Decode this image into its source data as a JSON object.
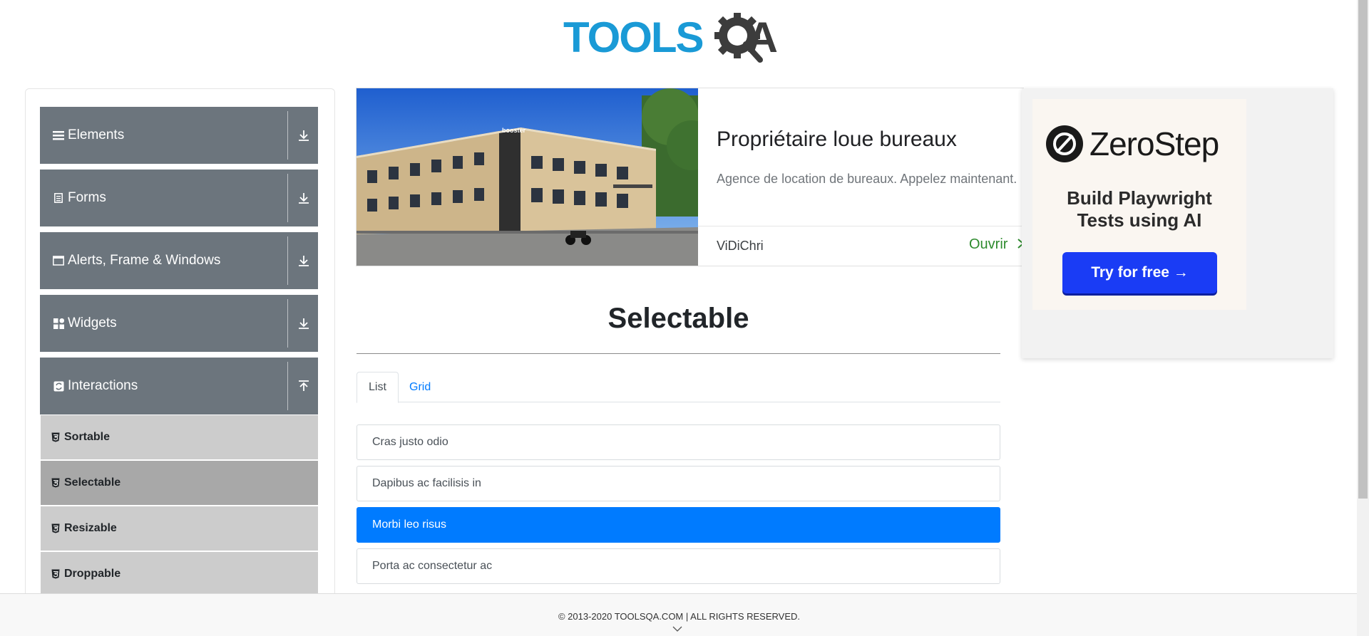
{
  "header": {
    "logo_tools": "TOOLS",
    "logo_qa": "A",
    "logo_icon": "gear-magnifier-icon"
  },
  "sidebar": {
    "groups": [
      {
        "label": "Elements",
        "icon": "hamburger-icon",
        "arrow": "download-icon"
      },
      {
        "label": "Forms",
        "icon": "document-icon",
        "arrow": "download-icon"
      },
      {
        "label": "Alerts, Frame & Windows",
        "icon": "window-icon",
        "arrow": "download-icon"
      },
      {
        "label": "Widgets",
        "icon": "grid-icon",
        "arrow": "download-icon"
      },
      {
        "label": "Interactions",
        "icon": "interaction-icon",
        "arrow": "upload-icon"
      }
    ],
    "items": [
      {
        "label": "Sortable"
      },
      {
        "label": "Selectable",
        "active": true
      },
      {
        "label": "Resizable"
      },
      {
        "label": "Droppable"
      }
    ]
  },
  "ad": {
    "title": "Propriétaire loue bureaux",
    "description": "Agence de location de bureaux. Appelez maintenant.",
    "advertiser": "ViDiChri",
    "cta": "Ouvrir",
    "building_sign": "booster"
  },
  "side_ad": {
    "brand": "ZeroStep",
    "tagline_line1": "Build Playwright",
    "tagline_line2": "Tests using AI",
    "button": "Try for free →"
  },
  "main": {
    "title": "Selectable",
    "tabs": [
      {
        "label": "List",
        "active": true
      },
      {
        "label": "Grid",
        "active": false
      }
    ],
    "list": [
      {
        "label": "Cras justo odio",
        "selected": false
      },
      {
        "label": "Dapibus ac facilisis in",
        "selected": false
      },
      {
        "label": "Morbi leo risus",
        "selected": true
      },
      {
        "label": "Porta ac consectetur ac",
        "selected": false
      }
    ]
  },
  "footer": {
    "text": "© 2013-2020 TOOLSQA.COM | ALL RIGHTS RESERVED."
  },
  "colors": {
    "brand_blue": "#1a9ad6",
    "sidebar_group": "#6c757d",
    "selected_blue": "#007bff",
    "cta_blue": "#1a3cf5"
  }
}
